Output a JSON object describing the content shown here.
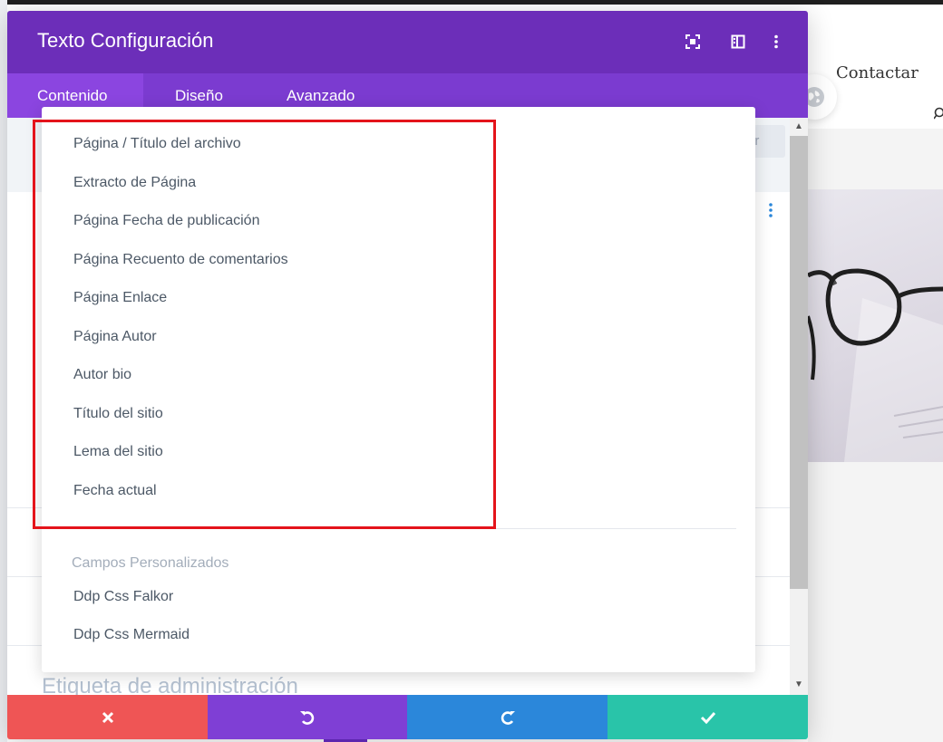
{
  "site": {
    "nav_link": "Contactar",
    "ghost_button_label": "ar"
  },
  "modal": {
    "title": "Texto Configuración",
    "tabs": [
      {
        "label": "Contenido",
        "active": true
      },
      {
        "label": "Diseño",
        "active": false
      },
      {
        "label": "Avanzado",
        "active": false
      }
    ],
    "icons": [
      "fullscreen-icon",
      "sidebar-layout-icon",
      "more-options-icon"
    ],
    "admin_label": "Etiqueta de administración"
  },
  "dropdown": {
    "items": [
      "Página / Título del archivo",
      "Extracto de Página",
      "Página Fecha de publicación",
      "Página Recuento de comentarios",
      "Página Enlace",
      "Página Autor",
      "Autor bio",
      "Título del sitio",
      "Lema del sitio",
      "Fecha actual"
    ],
    "section_title": "Campos Personalizados",
    "custom_fields": [
      "Ddp Css Falkor",
      "Ddp Css Mermaid"
    ]
  },
  "footer": {
    "buttons": [
      {
        "name": "discard",
        "icon": "close-icon",
        "color": "#ef5555"
      },
      {
        "name": "undo",
        "icon": "undo-icon",
        "color": "#7f3fd5"
      },
      {
        "name": "redo",
        "icon": "redo-icon",
        "color": "#2b87da"
      },
      {
        "name": "save",
        "icon": "check-icon",
        "color": "#29c4a9"
      }
    ]
  },
  "colors": {
    "header": "#6c2eb9",
    "tabs": "#7b3bd0",
    "highlight": "#e4141b"
  }
}
